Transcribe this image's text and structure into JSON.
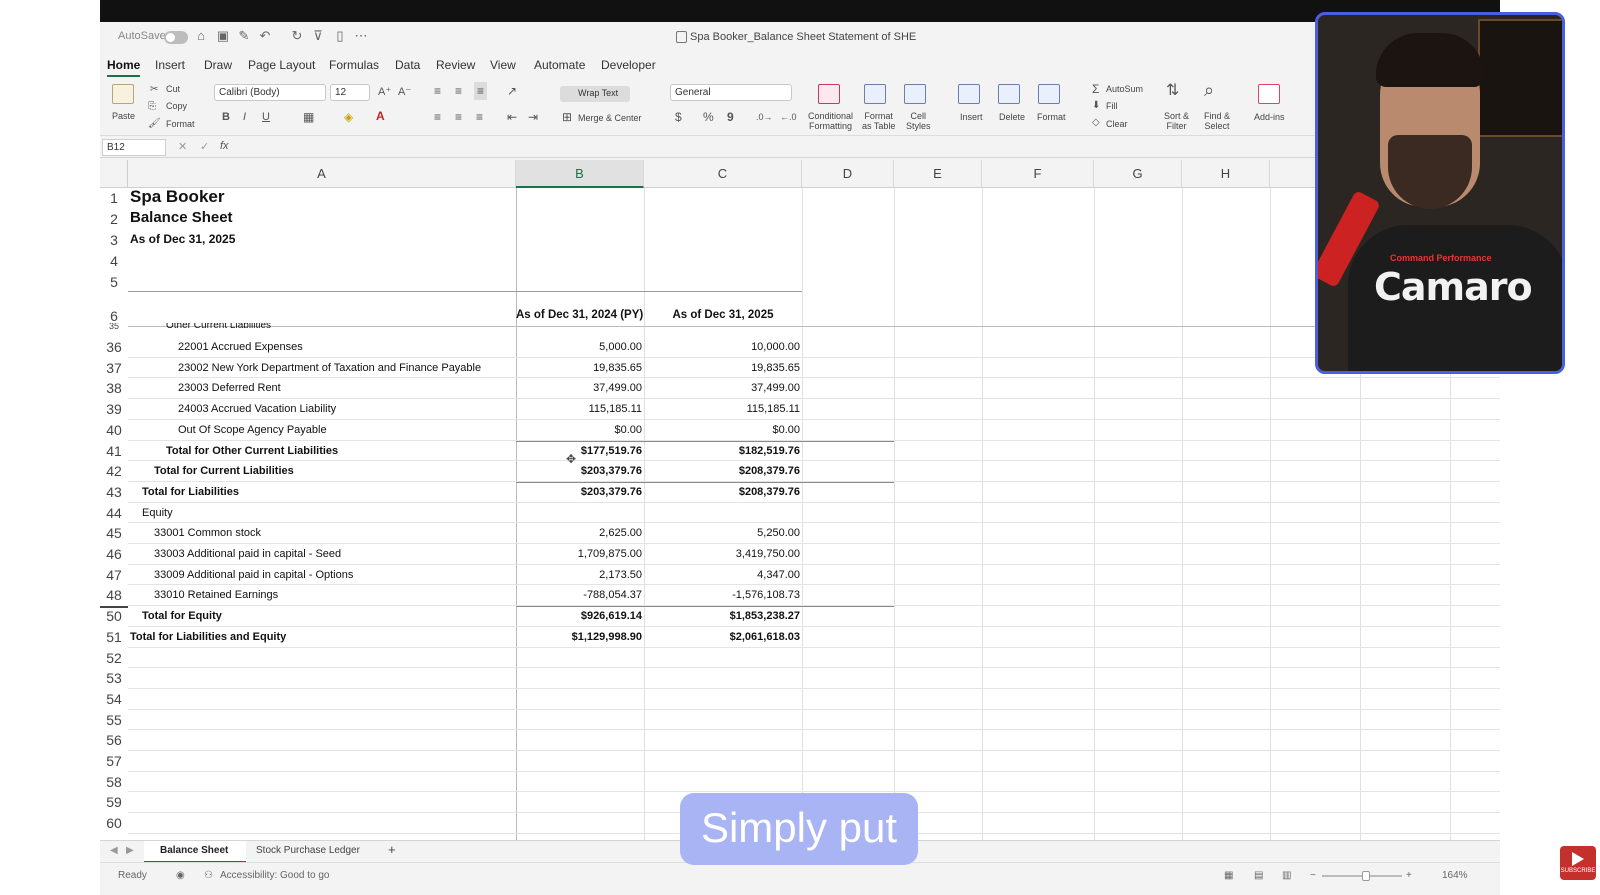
{
  "window": {
    "title": "Spa Booker_Balance Sheet Statement of SHE",
    "autosave_label": "AutoSave"
  },
  "ribbon_tabs": [
    "Home",
    "Insert",
    "Draw",
    "Page Layout",
    "Formulas",
    "Data",
    "Review",
    "View",
    "Automate",
    "Developer"
  ],
  "ribbon": {
    "paste": "Paste",
    "cut": "Cut",
    "copy": "Copy",
    "format_painter": "Format",
    "font_name": "Calibri (Body)",
    "font_size": "12",
    "wrap_text": "Wrap Text",
    "merge_center": "Merge & Center",
    "number_format": "General",
    "conditional_formatting": [
      "Conditional",
      "Formatting"
    ],
    "format_as_table": [
      "Format",
      "as Table"
    ],
    "cell_styles": [
      "Cell",
      "Styles"
    ],
    "insert": "Insert",
    "delete": "Delete",
    "format": "Format",
    "autosum": "AutoSum",
    "fill": "Fill",
    "clear": "Clear",
    "sort_filter": [
      "Sort &",
      "Filter"
    ],
    "find_select": [
      "Find &",
      "Select"
    ],
    "addins": "Add-ins",
    "bold": "B",
    "italic": "I",
    "underline": "U",
    "currency": "$",
    "percent": "%",
    "comma": "9"
  },
  "formula_bar": {
    "name_box": "B12",
    "fx": "fx"
  },
  "columns": [
    "A",
    "B",
    "C",
    "D",
    "E",
    "F",
    "G",
    "H"
  ],
  "sheet": {
    "header_rows": [
      {
        "num": "1",
        "a": "Spa Booker"
      },
      {
        "num": "2",
        "a": "Balance Sheet"
      },
      {
        "num": "3",
        "a": "As of Dec 31, 2025"
      },
      {
        "num": "4",
        "a": ""
      },
      {
        "num": "5",
        "a": ""
      }
    ],
    "row6": {
      "num": "6",
      "b": "As of Dec 31, 2024 (PY)",
      "c": "As of Dec 31, 2025"
    },
    "row35_partial": {
      "num": "35",
      "a": "Other Current Liabilities"
    },
    "rows": [
      {
        "num": "36",
        "a": "22001 Accrued Expenses",
        "b": "5,000.00",
        "c": "10,000.00"
      },
      {
        "num": "37",
        "a": "23002 New York Department of Taxation and Finance Payable",
        "b": "19,835.65",
        "c": "19,835.65"
      },
      {
        "num": "38",
        "a": "23003 Deferred Rent",
        "b": "37,499.00",
        "c": "37,499.00"
      },
      {
        "num": "39",
        "a": "24003 Accrued Vacation Liability",
        "b": "115,185.11",
        "c": "115,185.11"
      },
      {
        "num": "40",
        "a": "Out Of Scope Agency Payable",
        "b": "$0.00",
        "c": "$0.00"
      },
      {
        "num": "41",
        "a": "Total for Other Current Liabilities",
        "b": "$177,519.76",
        "c": "$182,519.76"
      },
      {
        "num": "42",
        "a": "Total for Current Liabilities",
        "b": "$203,379.76",
        "c": "$208,379.76"
      },
      {
        "num": "43",
        "a": "Total for Liabilities",
        "b": "$203,379.76",
        "c": "$208,379.76"
      },
      {
        "num": "44",
        "a": "Equity",
        "b": "",
        "c": ""
      },
      {
        "num": "45",
        "a": "33001 Common stock",
        "b": "2,625.00",
        "c": "5,250.00"
      },
      {
        "num": "46",
        "a": "33003 Additional paid in capital - Seed",
        "b": "1,709,875.00",
        "c": "3,419,750.00"
      },
      {
        "num": "47",
        "a": "33009 Additional paid in capital - Options",
        "b": "2,173.50",
        "c": "4,347.00"
      },
      {
        "num": "48",
        "a": "33010 Retained Earnings",
        "b": "-788,054.37",
        "c": "-1,576,108.73"
      },
      {
        "num": "50",
        "a": "Total for Equity",
        "b": "$926,619.14",
        "c": "$1,853,238.27"
      },
      {
        "num": "51",
        "a": "Total for Liabilities and Equity",
        "b": "$1,129,998.90",
        "c": "$2,061,618.03"
      },
      {
        "num": "52",
        "a": "",
        "b": "",
        "c": ""
      },
      {
        "num": "53",
        "a": "",
        "b": "",
        "c": ""
      },
      {
        "num": "54",
        "a": "",
        "b": "",
        "c": ""
      },
      {
        "num": "55",
        "a": "",
        "b": "",
        "c": ""
      },
      {
        "num": "56",
        "a": "",
        "b": "",
        "c": ""
      },
      {
        "num": "57",
        "a": "",
        "b": "",
        "c": ""
      },
      {
        "num": "58",
        "a": "",
        "b": "",
        "c": ""
      },
      {
        "num": "59",
        "a": "",
        "b": "",
        "c": ""
      },
      {
        "num": "60",
        "a": "",
        "b": "",
        "c": ""
      }
    ]
  },
  "sheet_tabs": [
    "Balance Sheet",
    "Stock Purchase Ledger"
  ],
  "add_sheet": "+",
  "status": {
    "ready": "Ready",
    "accessibility": "Accessibility: Good to go",
    "zoom": "164%"
  },
  "overlay": {
    "caption": "Simply put",
    "shirt_text": "Camaro",
    "shirt_sub": "Command Performance",
    "subscribe": "SUBSCRIBE"
  },
  "colors": {
    "excel_green": "#1e7145",
    "caption_bg": "#a9b4f4",
    "webcam_border": "#4a5ee0"
  }
}
